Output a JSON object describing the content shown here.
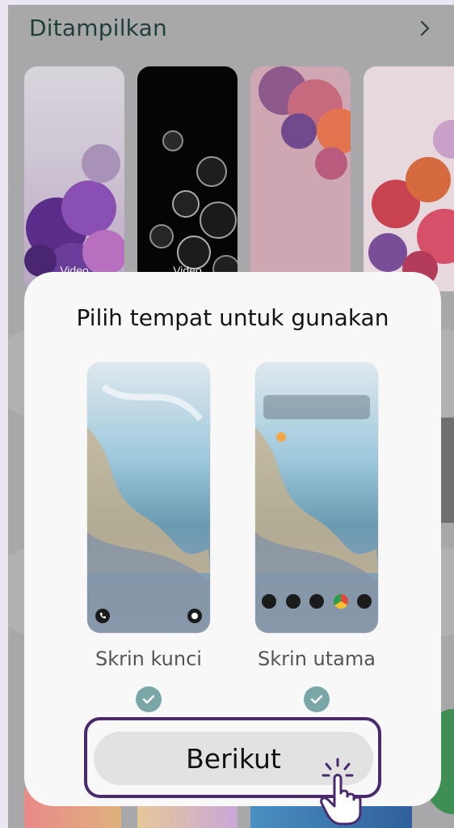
{
  "header": {
    "title": "Ditampilkan",
    "more_icon": "chevron-right-icon"
  },
  "wallpapers": [
    {
      "label": "Video"
    },
    {
      "label": "Video"
    },
    {
      "label": ""
    },
    {
      "label": ""
    }
  ],
  "dialog": {
    "title": "Pilih tempat untuk gunakan",
    "options": [
      {
        "label": "Skrin kunci",
        "checked": true
      },
      {
        "label": "Skrin utama",
        "checked": true
      }
    ],
    "next_label": "Berikut"
  },
  "colors": {
    "accent_check": "#7aa6a6",
    "highlight_outline": "#4a2a6c",
    "title_text": "#1f3e3a"
  }
}
